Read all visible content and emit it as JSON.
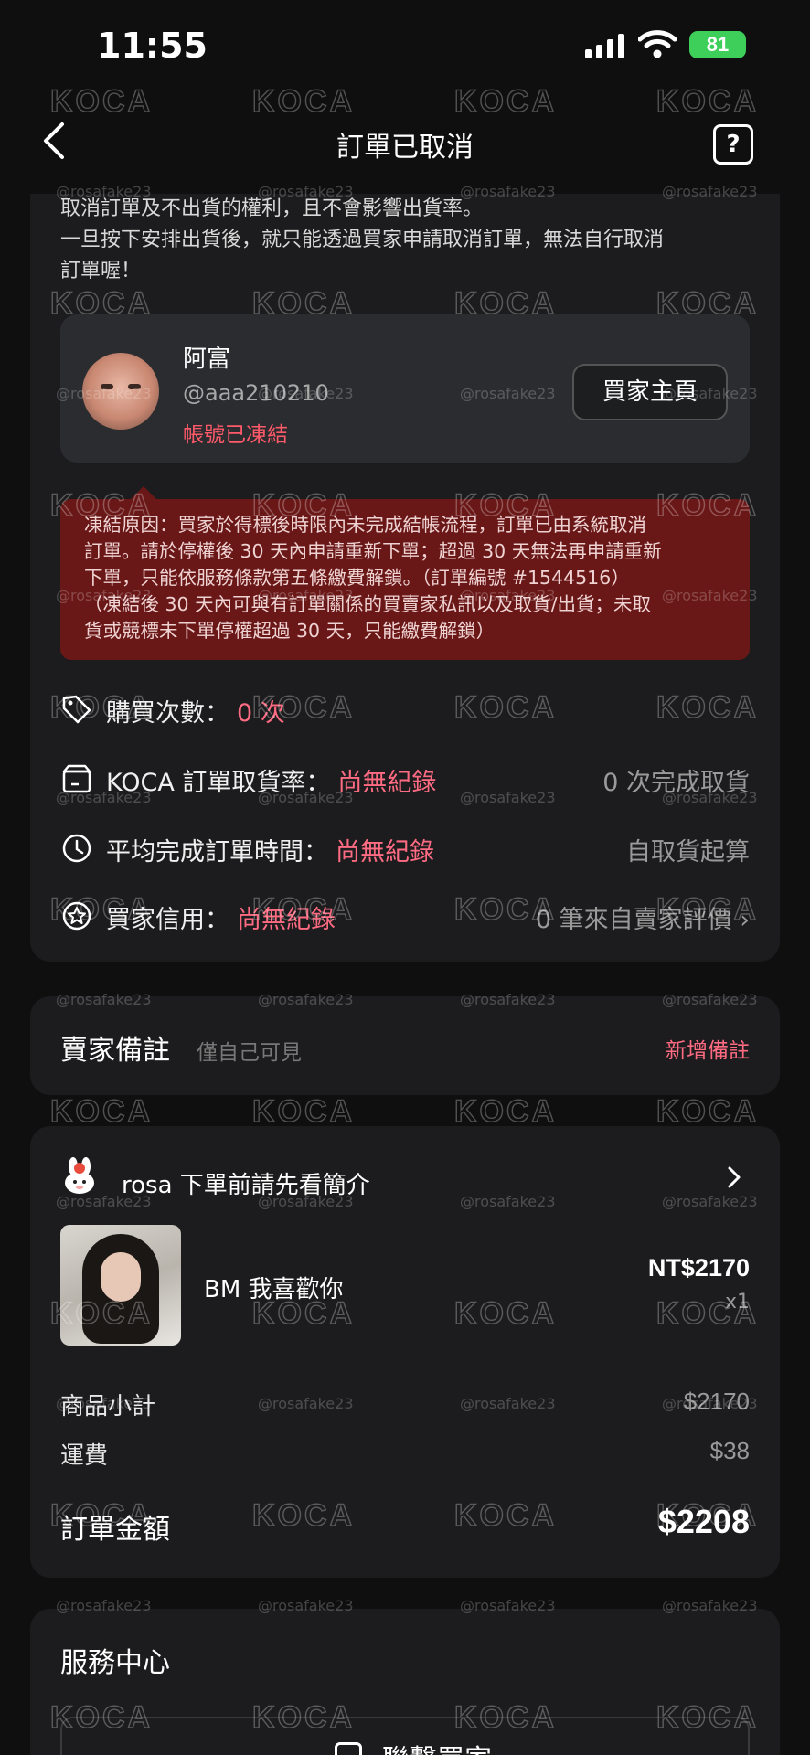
{
  "status_bar": {
    "time": "11:55",
    "battery": "81"
  },
  "nav": {
    "title": "訂單已取消",
    "help_icon": "?"
  },
  "notice": {
    "line1": "取消訂單及不出貨的權利，且不會影響出貨率。",
    "line2": "一旦按下安排出貨後，就只能透過買家申請取消訂單，無法自行取消",
    "line3": "訂單喔！"
  },
  "buyer": {
    "name": "阿富",
    "handle": "@aaa210210",
    "status": "帳號已凍結",
    "page_button": "買家主頁"
  },
  "freeze": {
    "line1": "凍結原因：買家於得標後時限內未完成結帳流程，訂單已由系統取消",
    "line2": "訂單。請於停權後 30 天內申請重新下單；超過 30 天無法再申請重新",
    "line3": "下單，只能依服務條款第五條繳費解鎖。（訂單編號 #1544516）",
    "line4": "（凍結後 30 天內可與有訂單關係的買賣家私訊以及取貨/出貨；未取",
    "line5": "貨或競標未下單停權超過 30 天，只能繳費解鎖）"
  },
  "stats": {
    "purchases": {
      "label": "購買次數：",
      "value": "0 次"
    },
    "pickup_rate": {
      "label": "KOCA 訂單取貨率：",
      "value": "尚無紀錄",
      "right": "0 次完成取貨"
    },
    "avg_time": {
      "label": "平均完成訂單時間：",
      "value": "尚無紀錄",
      "right": "自取貨起算"
    },
    "credit": {
      "label": "買家信用：",
      "value": "尚無紀錄",
      "right": "0 筆來自賣家評價 ›"
    }
  },
  "seller_notes": {
    "title": "賣家備註",
    "subtitle": "僅自己可見",
    "add": "新增備註"
  },
  "order": {
    "shop_name": "rosa 下單前請先看簡介",
    "product_name": "BM 我喜歡你",
    "product_price": "NT$2170",
    "product_qty": "x1",
    "subtotal_label": "商品小計",
    "subtotal_value": "$2170",
    "shipping_label": "運費",
    "shipping_value": "$38",
    "total_label": "訂單金額",
    "total_value": "$2208"
  },
  "service": {
    "title": "服務中心",
    "contact_button": "聯繫買家"
  },
  "watermark": {
    "logo": "KOCA",
    "handle": "@rosafake23"
  },
  "colors": {
    "accent_pink": "#ff6b82",
    "freeze_red": "#6a1717",
    "battery_green": "#3ecf5a"
  }
}
